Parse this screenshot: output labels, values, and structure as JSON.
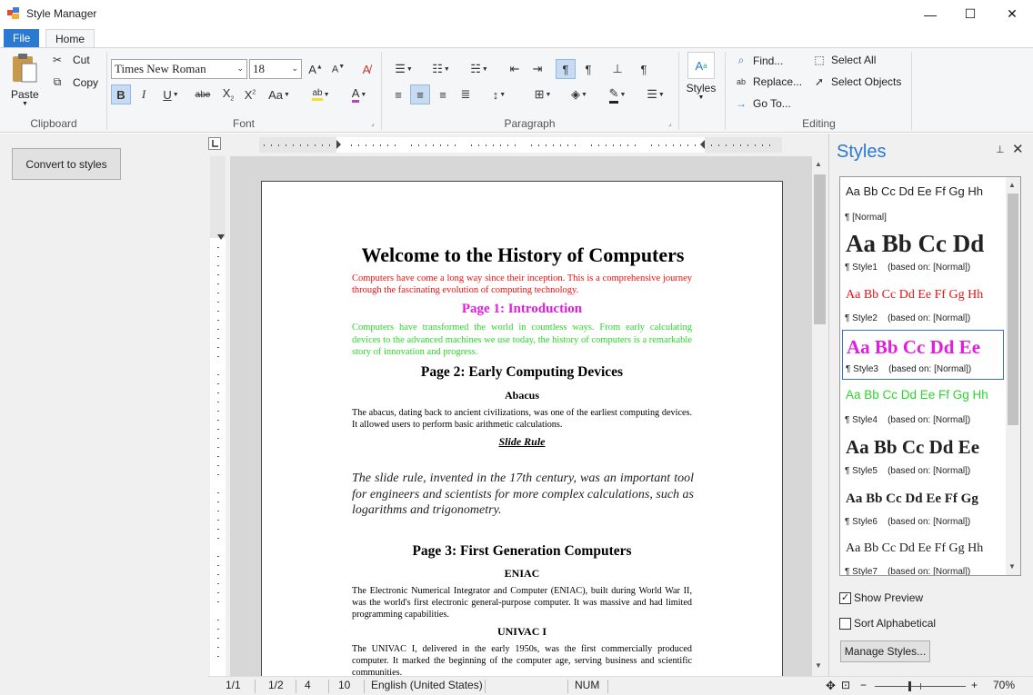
{
  "window": {
    "title": "Style Manager",
    "minimize": "—",
    "maximize": "☐",
    "close": "✕"
  },
  "tabs": [
    {
      "label": "File"
    },
    {
      "label": "Home"
    }
  ],
  "ribbon": {
    "clipboard": {
      "paste": "Paste",
      "cut": "Cut",
      "copy": "Copy",
      "group": "Clipboard"
    },
    "font": {
      "family": "Times New Roman",
      "size": "18",
      "group": "Font"
    },
    "paragraph": {
      "group": "Paragraph"
    },
    "styles": {
      "label": "Styles"
    },
    "editing": {
      "find": "Find...",
      "replace": "Replace...",
      "goto": "Go To...",
      "select_all": "Select All",
      "select_objects": "Select Objects",
      "group": "Editing"
    }
  },
  "left": {
    "convert": "Convert to styles"
  },
  "document": {
    "title": "Welcome to the History of Computers",
    "intro": "Computers have come a long way since their inception. This is a comprehensive journey through the fascinating evolution of computing technology.",
    "p1_heading": "Page 1: Introduction",
    "p1_text": "Computers have transformed the world in countless ways. From early calculating devices to the advanced machines we use today, the history of computers is a remarkable story of innovation and progress.",
    "p2_heading": "Page 2: Early Computing Devices",
    "abacus_heading": "Abacus",
    "abacus_text": "The abacus, dating back to ancient civilizations, was one of the earliest computing devices. It allowed users to perform basic arithmetic calculations.",
    "slide_heading": "Slide Rule",
    "slide_text": "The slide rule, invented in the 17th century, was an important tool for engineers and scientists for more complex calculations, such as logarithms and trigonometry.",
    "p3_heading": "Page 3: First Generation Computers",
    "eniac_heading": "ENIAC",
    "eniac_text": "The Electronic Numerical Integrator and Computer (ENIAC), built during World War II, was the world's first electronic general-purpose computer. It was massive and had limited programming capabilities.",
    "univac_heading": "UNIVAC I",
    "univac_text": "The UNIVAC I, delivered in the early 1950s, was the first commercially produced computer. It marked the beginning of the computer age, serving business and scientific communities."
  },
  "styles_pane": {
    "title": "Styles",
    "items": [
      {
        "preview": "Aa Bb Cc Dd Ee Ff Gg Hh",
        "name": "¶ [Normal]",
        "based": ""
      },
      {
        "preview": "Aa Bb Cc Dd",
        "name": "¶ Style1",
        "based": "(based on: [Normal])"
      },
      {
        "preview": "Aa Bb Cc Dd Ee Ff Gg Hh",
        "name": "¶ Style2",
        "based": "(based on: [Normal])"
      },
      {
        "preview": "Aa Bb Cc Dd Ee",
        "name": "¶ Style3",
        "based": "(based on: [Normal])"
      },
      {
        "preview": "Aa Bb Cc Dd Ee Ff Gg Hh",
        "name": "¶ Style4",
        "based": "(based on: [Normal])"
      },
      {
        "preview": "Aa Bb Cc Dd Ee",
        "name": "¶ Style5",
        "based": "(based on: [Normal])"
      },
      {
        "preview": "Aa Bb Cc Dd Ee Ff Gg",
        "name": "¶ Style6",
        "based": "(based on: [Normal])"
      },
      {
        "preview": "Aa Bb Cc Dd Ee Ff Gg Hh",
        "name": "¶ Style7",
        "based": "(based on: [Normal])"
      }
    ],
    "show_preview": "Show Preview",
    "sort_alpha": "Sort Alphabetical",
    "manage": "Manage Styles..."
  },
  "status": {
    "page": "1/1",
    "section": "1/2",
    "line": "4",
    "col": "10",
    "language": "English (United States)",
    "num": "NUM",
    "zoom": "70%"
  },
  "colors": {
    "accent": "#2b79d0",
    "red": "#e11111",
    "magenta": "#e21de0",
    "green": "#2ad82a"
  }
}
